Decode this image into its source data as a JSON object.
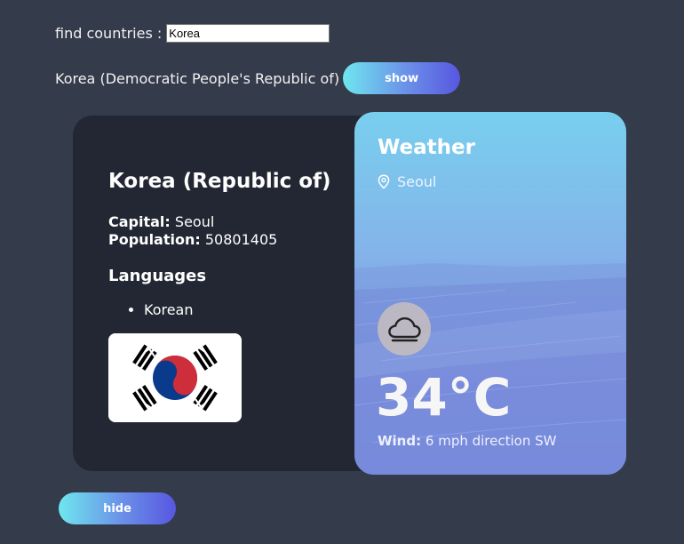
{
  "search": {
    "label": "find countries :",
    "value": "Korea"
  },
  "result": {
    "name": "Korea (Democratic People's Republic of)",
    "show_label": "show"
  },
  "country": {
    "name": "Korea (Republic of)",
    "capital_label": "Capital:",
    "capital": "Seoul",
    "population_label": "Population:",
    "population": "50801405",
    "languages_title": "Languages",
    "languages": [
      "Korean"
    ],
    "flag": "south-korea-flag"
  },
  "weather": {
    "title": "Weather",
    "location": "Seoul",
    "condition_icon": "cloud-icon",
    "temperature": "34°C",
    "wind_label": "Wind:",
    "wind": "6 mph direction SW"
  },
  "hide_label": "hide",
  "colors": {
    "background": "#343b4b",
    "card": "#222733",
    "button_gradient_start": "#6fe6ef",
    "button_gradient_end": "#5757e0"
  }
}
